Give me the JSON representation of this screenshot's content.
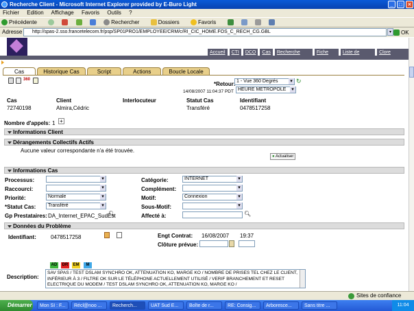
{
  "window": {
    "title": "Recherche Client - Microsoft Internet Explorer provided by E-Buro Light"
  },
  "menu": [
    "Fichier",
    "Edition",
    "Affichage",
    "Favoris",
    "Outils",
    "?"
  ],
  "toolbar": {
    "back": "Précédente",
    "search": "Rechercher",
    "folders": "Dossiers",
    "favorites": "Favoris"
  },
  "address": {
    "label": "Adresse",
    "url": "http://spas-2.sso.francetelecom.fr/psp/SP01PRO1/EMPLOYEE/CRM/c/RI_CIC_HOME.FOS_C_RECH_CG.GBL",
    "go": "OK"
  },
  "topnav": [
    "Accueil",
    "CTI",
    "DCO",
    "Cas",
    "Recherche client",
    "Fiche Info",
    "Liste de tâches",
    "Clore session"
  ],
  "tabs": [
    "Cas",
    "Historique Cas",
    "Script",
    "Actions",
    "Boucle Locale"
  ],
  "retour": {
    "label": "*Retour:",
    "value": "1 - Vue 360 Degrés"
  },
  "timestamp": "14/08/2007 11:04:37 PDT",
  "timezone": "HEURE METROPOLE",
  "case": {
    "headers": [
      "Cas",
      "Client",
      "Interlocuteur",
      "Statut Cas",
      "Identifiant"
    ],
    "values": [
      "72740198",
      "Almira,Cédric",
      "",
      "Transféré",
      "0478517258"
    ]
  },
  "appels": {
    "label": "Nombre d'appels:",
    "value": "1"
  },
  "sections": {
    "client": "Informations Client",
    "derangements": "Dérangements Collectifs Actifs",
    "infocas": "Informations Cas",
    "probleme": "Données du Problème"
  },
  "no_value": "Aucune valeur correspondante n'a été trouvée.",
  "actualiser": "Actualiser",
  "infocas": {
    "processus": "Processus:",
    "raccourci": "Raccourci:",
    "priorite": "Priorité:",
    "priorite_val": "Normale",
    "statut": "*Statut Cas:",
    "statut_val": "Transféré",
    "gp": "Gp Prestataires:",
    "gp_val": "DA_Internet_EPAC_SudEst",
    "categorie": "Catégorie:",
    "categorie_val": "INTERNET",
    "complement": "Complément:",
    "motif": "Motif:",
    "motif_val": "Connexion",
    "sousmotif": "Sous-Motif:",
    "affecte": "Affecté à:"
  },
  "probleme": {
    "identifiant": "Identifiant:",
    "identifiant_val": "0478517258",
    "engt": "Engt Contrat:",
    "engt_date": "16/08/2007",
    "engt_time": "19:37",
    "cloture": "Clôture prévue:",
    "description": "Description:",
    "desc_text": "SAV SPAS / TEST DSLAM SYNCHRO OK, ATTENUATION KO, MARGE KO / NOMBRE DE PRISES TEL CHEZ LE CLIENT, INFÉRIEUR À 3 / FILTRE OK SUR LE TÉLÉPHONE ACTUELLEMENT UTILISÉ / VERIF BRANCHEMENT ET RESET ELECTRIQUE DU MODEM / TEST DSLAM SYNCHRO OK, ATTENUATION KO, MARGE KO /"
  },
  "colorbtns": [
    {
      "label": "AD",
      "color": "#3cb43c"
    },
    {
      "label": "DR",
      "color": "#e02020"
    },
    {
      "label": "EM",
      "color": "#f0d020"
    },
    {
      "label": "M",
      "color": "#40a8e8"
    }
  ],
  "status": {
    "zone": "Sites de confiance"
  },
  "taskbar": {
    "start": "Démarrer",
    "items": [
      "Mon SI : F...",
      "Récl@noo ...",
      "Recherch...",
      "UAT Sud E...",
      "Boîte de r...",
      "RE: Consig...",
      "Arboresce...",
      "Sans titre ..."
    ],
    "clock": "11:04"
  }
}
